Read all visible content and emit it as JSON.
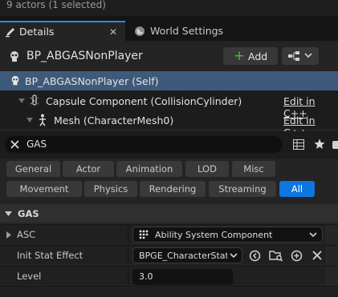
{
  "status": {
    "actors_text": "9 actors (1 selected)"
  },
  "tabs": [
    {
      "label": "Details"
    },
    {
      "label": "World Settings"
    }
  ],
  "header": {
    "title": "BP_ABGASNonPlayer",
    "add_label": "Add"
  },
  "components": [
    {
      "label": "BP_ABGASNonPlayer (Self)",
      "selected": true
    },
    {
      "label": "Capsule Component (CollisionCylinder)",
      "action": "Edit in C++"
    },
    {
      "label": "Mesh (CharacterMesh0)",
      "action": "Edit in C++"
    }
  ],
  "search": {
    "value": "GAS"
  },
  "filters": {
    "row1": [
      "General",
      "Actor",
      "Animation",
      "LOD",
      "Misc"
    ],
    "row2": [
      "Movement",
      "Physics",
      "Rendering",
      "Streaming",
      "All"
    ],
    "active": "All"
  },
  "section": {
    "title": "GAS"
  },
  "properties": [
    {
      "label": "ASC",
      "value": "Ability System Component"
    },
    {
      "label": "Init Stat Effect",
      "value": "BPGE_CharacterStat"
    },
    {
      "label": "Level",
      "value": "3.0"
    }
  ],
  "colors": {
    "accent": "#0f76e0",
    "selection": "#3e5a7a",
    "add_icon": "#3fbf3f",
    "tab_highlight": "#2b8de8"
  },
  "icons": {
    "details_tab": "details-pencil-icon",
    "world_tab": "globe-icon",
    "actor": "skull-actor-icon",
    "add": "plus-icon",
    "blueprint_menu": "blueprint-tree-icon",
    "capsule": "capsule-icon",
    "mesh": "skeletal-mesh-icon",
    "search_clear": "close-icon",
    "table_view": "table-icon",
    "favorite": "star-icon",
    "section_toggle": "triangle-down-icon",
    "asc_type": "component-icon",
    "browse": "arrow-browse-icon",
    "find": "folder-search-icon",
    "create": "plus-circle-icon",
    "clear": "x-icon"
  }
}
